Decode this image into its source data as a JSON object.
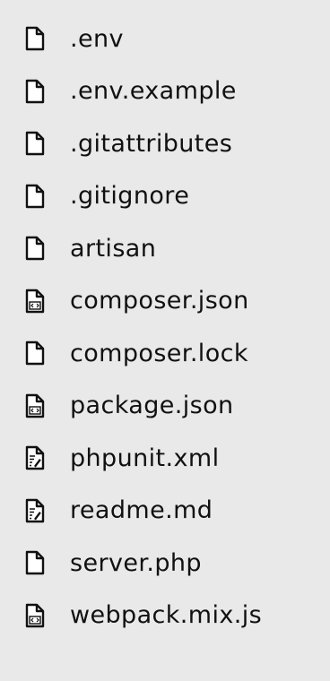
{
  "files": [
    {
      "name": ".env",
      "icon": "file-icon"
    },
    {
      "name": ".env.example",
      "icon": "file-icon"
    },
    {
      "name": ".gitattributes",
      "icon": "file-icon"
    },
    {
      "name": ".gitignore",
      "icon": "file-icon"
    },
    {
      "name": "artisan",
      "icon": "file-icon"
    },
    {
      "name": "composer.json",
      "icon": "code-file-icon"
    },
    {
      "name": "composer.lock",
      "icon": "file-icon"
    },
    {
      "name": "package.json",
      "icon": "code-file-icon"
    },
    {
      "name": "phpunit.xml",
      "icon": "text-file-icon"
    },
    {
      "name": "readme.md",
      "icon": "text-file-icon"
    },
    {
      "name": "server.php",
      "icon": "file-icon"
    },
    {
      "name": "webpack.mix.js",
      "icon": "code-file-icon"
    }
  ],
  "colors": {
    "background": "#e9e9e9",
    "text": "#111111",
    "icon_stroke": "#111111"
  }
}
